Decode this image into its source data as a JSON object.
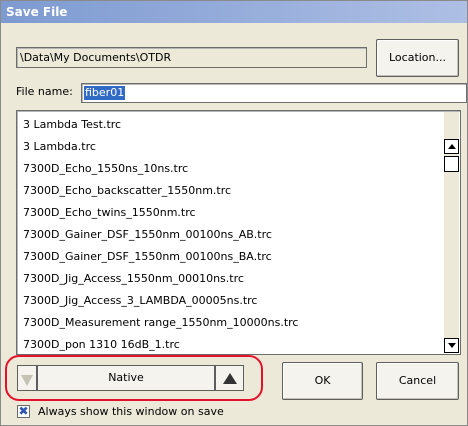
{
  "window": {
    "title": "Save File"
  },
  "location": {
    "path": "\\Data\\My Documents\\OTDR",
    "button_label": "Location..."
  },
  "file_name": {
    "label": "File name:",
    "value": "fiber01"
  },
  "file_list": {
    "items": [
      "3 Lambda Test.trc",
      "3 Lambda.trc",
      "7300D_Echo_1550ns_10ns.trc",
      "7300D_Echo_backscatter_1550nm.trc",
      "7300D_Echo_twins_1550nm.trc",
      "7300D_Gainer_DSF_1550nm_00100ns_AB.trc",
      "7300D_Gainer_DSF_1550nm_00100ns_BA.trc",
      "7300D_Jig_Access_1550nm_00010ns.trc",
      "7300D_Jig_Access_3_LAMBDA_00005ns.trc",
      "7300D_Measurement range_1550nm_10000ns.trc",
      "7300D_pon 1310 16dB_1.trc"
    ]
  },
  "format": {
    "value": "Native"
  },
  "buttons": {
    "ok": "OK",
    "cancel": "Cancel"
  },
  "always_show": {
    "label": "Always show this window on save",
    "checked": true,
    "mark": "✖"
  },
  "colors": {
    "highlight_ring": "#e3122a",
    "title_bar": "#7d9ad1",
    "selection": "#316ac5"
  }
}
